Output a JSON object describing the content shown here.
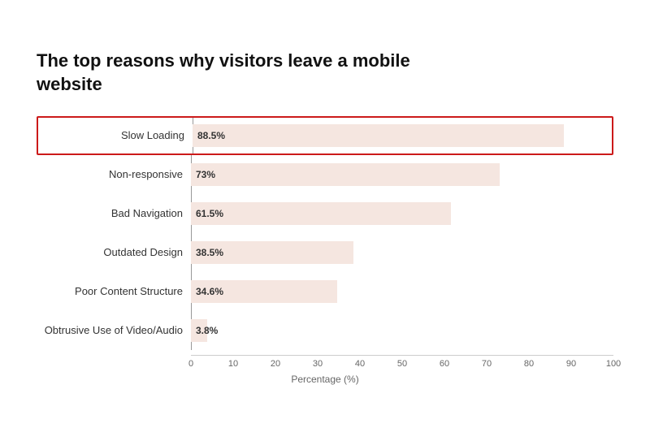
{
  "chart": {
    "title": "The top reasons why visitors leave a mobile website",
    "bars": [
      {
        "label": "Slow Loading",
        "value": 88.5,
        "display": "88.5%",
        "highlighted": true
      },
      {
        "label": "Non-responsive",
        "value": 73,
        "display": "73%",
        "highlighted": false
      },
      {
        "label": "Bad Navigation",
        "value": 61.5,
        "display": "61.5%",
        "highlighted": false
      },
      {
        "label": "Outdated Design",
        "value": 38.5,
        "display": "38.5%",
        "highlighted": false
      },
      {
        "label": "Poor Content Structure",
        "value": 34.6,
        "display": "34.6%",
        "highlighted": false
      },
      {
        "label": "Obtrusive Use of Video/Audio",
        "value": 3.8,
        "display": "3.8%",
        "highlighted": false
      }
    ],
    "x_axis": {
      "title": "Percentage (%)",
      "ticks": [
        0,
        10,
        20,
        30,
        40,
        50,
        60,
        70,
        80,
        90,
        100
      ]
    }
  }
}
